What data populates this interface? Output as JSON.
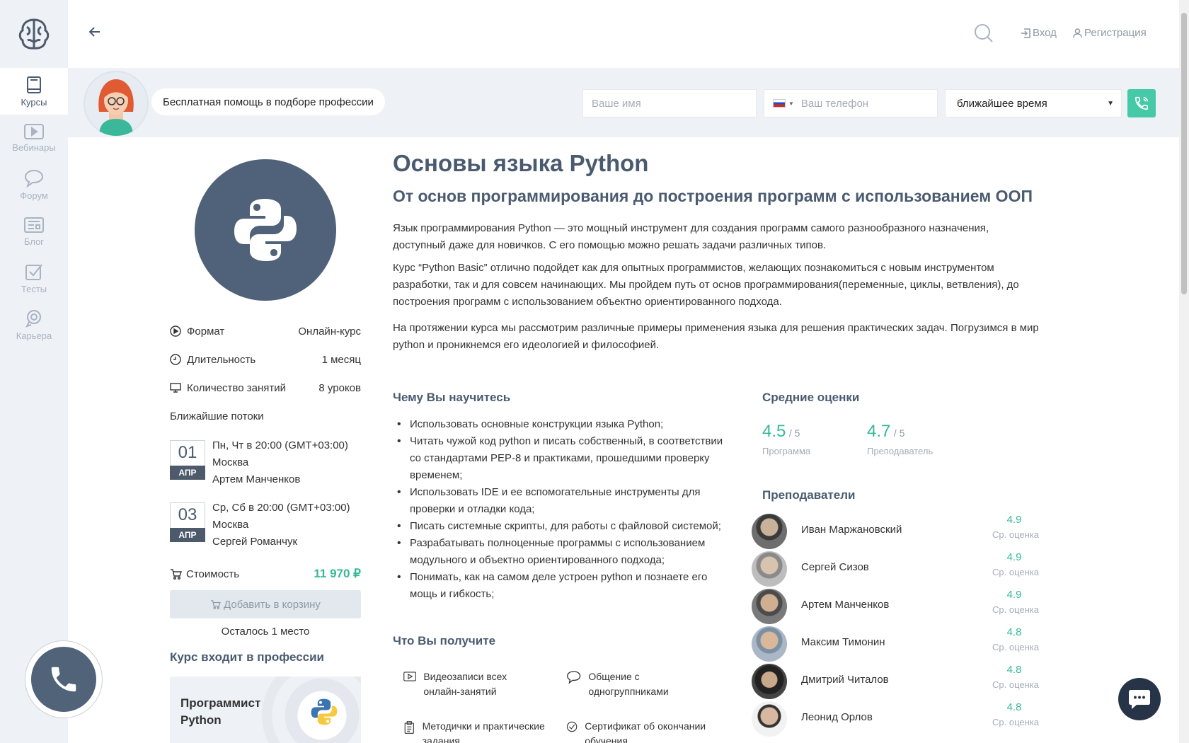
{
  "sidebar": {
    "items": [
      {
        "label": "Курсы",
        "icon": "book-icon"
      },
      {
        "label": "Вебинары",
        "icon": "play-icon"
      },
      {
        "label": "Форум",
        "icon": "chat-bubble-icon"
      },
      {
        "label": "Блог",
        "icon": "newspaper-icon"
      },
      {
        "label": "Тесты",
        "icon": "checkbox-icon"
      },
      {
        "label": "Карьера",
        "icon": "rocket-icon"
      }
    ]
  },
  "header": {
    "login": "Вход",
    "register": "Регистрация"
  },
  "helpbar": {
    "text": "Бесплатная помощь в подборе профессии",
    "name_placeholder": "Ваше имя",
    "phone_placeholder": "Ваш телефон",
    "time_value": "ближайшее время"
  },
  "course": {
    "title": "Основы языка Python",
    "subtitle": "От основ программирования до построения программ с использованием ООП",
    "paragraphs": [
      "Язык программирования Python — это мощный инструмент для создания программ самого разнообразного назначения, доступный даже для новичков. С его помощью можно решать задачи различных типов.",
      "Курс “Python Basic” отлично подойдет как для опытных программистов, желающих познакомиться с новым инструментом разработки, так и для совсем начинающих. Мы пройдем путь от основ программирования(переменные, циклы, ветвления), до построения программ с использованием объектно ориентированного подхода.",
      "На протяжении курса мы рассмотрим различные примеры применения языка для решения практических задач. Погрузимся в мир python и проникнемся его идеологией и философией."
    ]
  },
  "info": {
    "format_label": "Формат",
    "format_value": "Онлайн-курс",
    "duration_label": "Длительность",
    "duration_value": "1 месяц",
    "lessons_label": "Количество занятий",
    "lessons_value": "8 уроков",
    "streams_title": "Ближайшие потоки",
    "streams": [
      {
        "day": "01",
        "month": "АПР",
        "schedule": "Пн, Чт в 20:00 (GMT+03:00)",
        "city": "Москва",
        "teacher": "Артем Манченков"
      },
      {
        "day": "03",
        "month": "АПР",
        "schedule": "Ср, Сб в 20:00 (GMT+03:00)",
        "city": "Москва",
        "teacher": "Сергей Романчук"
      }
    ],
    "price_label": "Стоимость",
    "price_value": "11 970 ₽",
    "cart_button": "Добавить в корзину",
    "seats_left": "Осталось 1 место",
    "profession_title": "Курс входит в профессии",
    "profession_name": "Программист Python"
  },
  "learn": {
    "title": "Чему Вы научитесь",
    "items": [
      "Использовать основные конструкции языка Python;",
      "Читать чужой код python и писать собственный, в соответствии со стандартами PEP-8 и практиками, прошедшими проверку временем;",
      "Использовать IDE и ее вспомогательные инструменты для проверки и отладки кода;",
      "Писать системные скрипты, для работы с файловой системой;",
      "Разрабатывать полноценные программы с использованием модульного и объектно ориентированного подхода;",
      "Понимать, как на самом деле устроен python и познаете его мощь и гибкость;"
    ]
  },
  "get": {
    "title": "Что Вы получите",
    "items": [
      {
        "icon": "video-icon",
        "text": "Видеозаписи всех онлайн-занятий"
      },
      {
        "icon": "speech-bubble-icon",
        "text": "Общение с одногруппниками"
      },
      {
        "icon": "clipboard-icon",
        "text": "Методички и практические задания"
      },
      {
        "icon": "certificate-check-icon",
        "text": "Сертификат об окончании обучения"
      }
    ]
  },
  "ratings": {
    "title": "Средние оценки",
    "items": [
      {
        "value": "4.5",
        "max": "/ 5",
        "label": "Программа"
      },
      {
        "value": "4.7",
        "max": "/ 5",
        "label": "Преподаватель"
      }
    ]
  },
  "teachers": {
    "title": "Преподаватели",
    "score_label": "Ср. оценка",
    "items": [
      {
        "name": "Иван Маржановский",
        "score": "4.9"
      },
      {
        "name": "Сергей Сизов",
        "score": "4.9"
      },
      {
        "name": "Артем Манченков",
        "score": "4.9"
      },
      {
        "name": "Максим Тимонин",
        "score": "4.8"
      },
      {
        "name": "Дмитрий Читалов",
        "score": "4.8"
      },
      {
        "name": "Леонид Орлов",
        "score": "4.8"
      }
    ]
  },
  "colors": {
    "accent": "#35b996",
    "primary": "#4a5b70",
    "call": "#45c9a6"
  }
}
